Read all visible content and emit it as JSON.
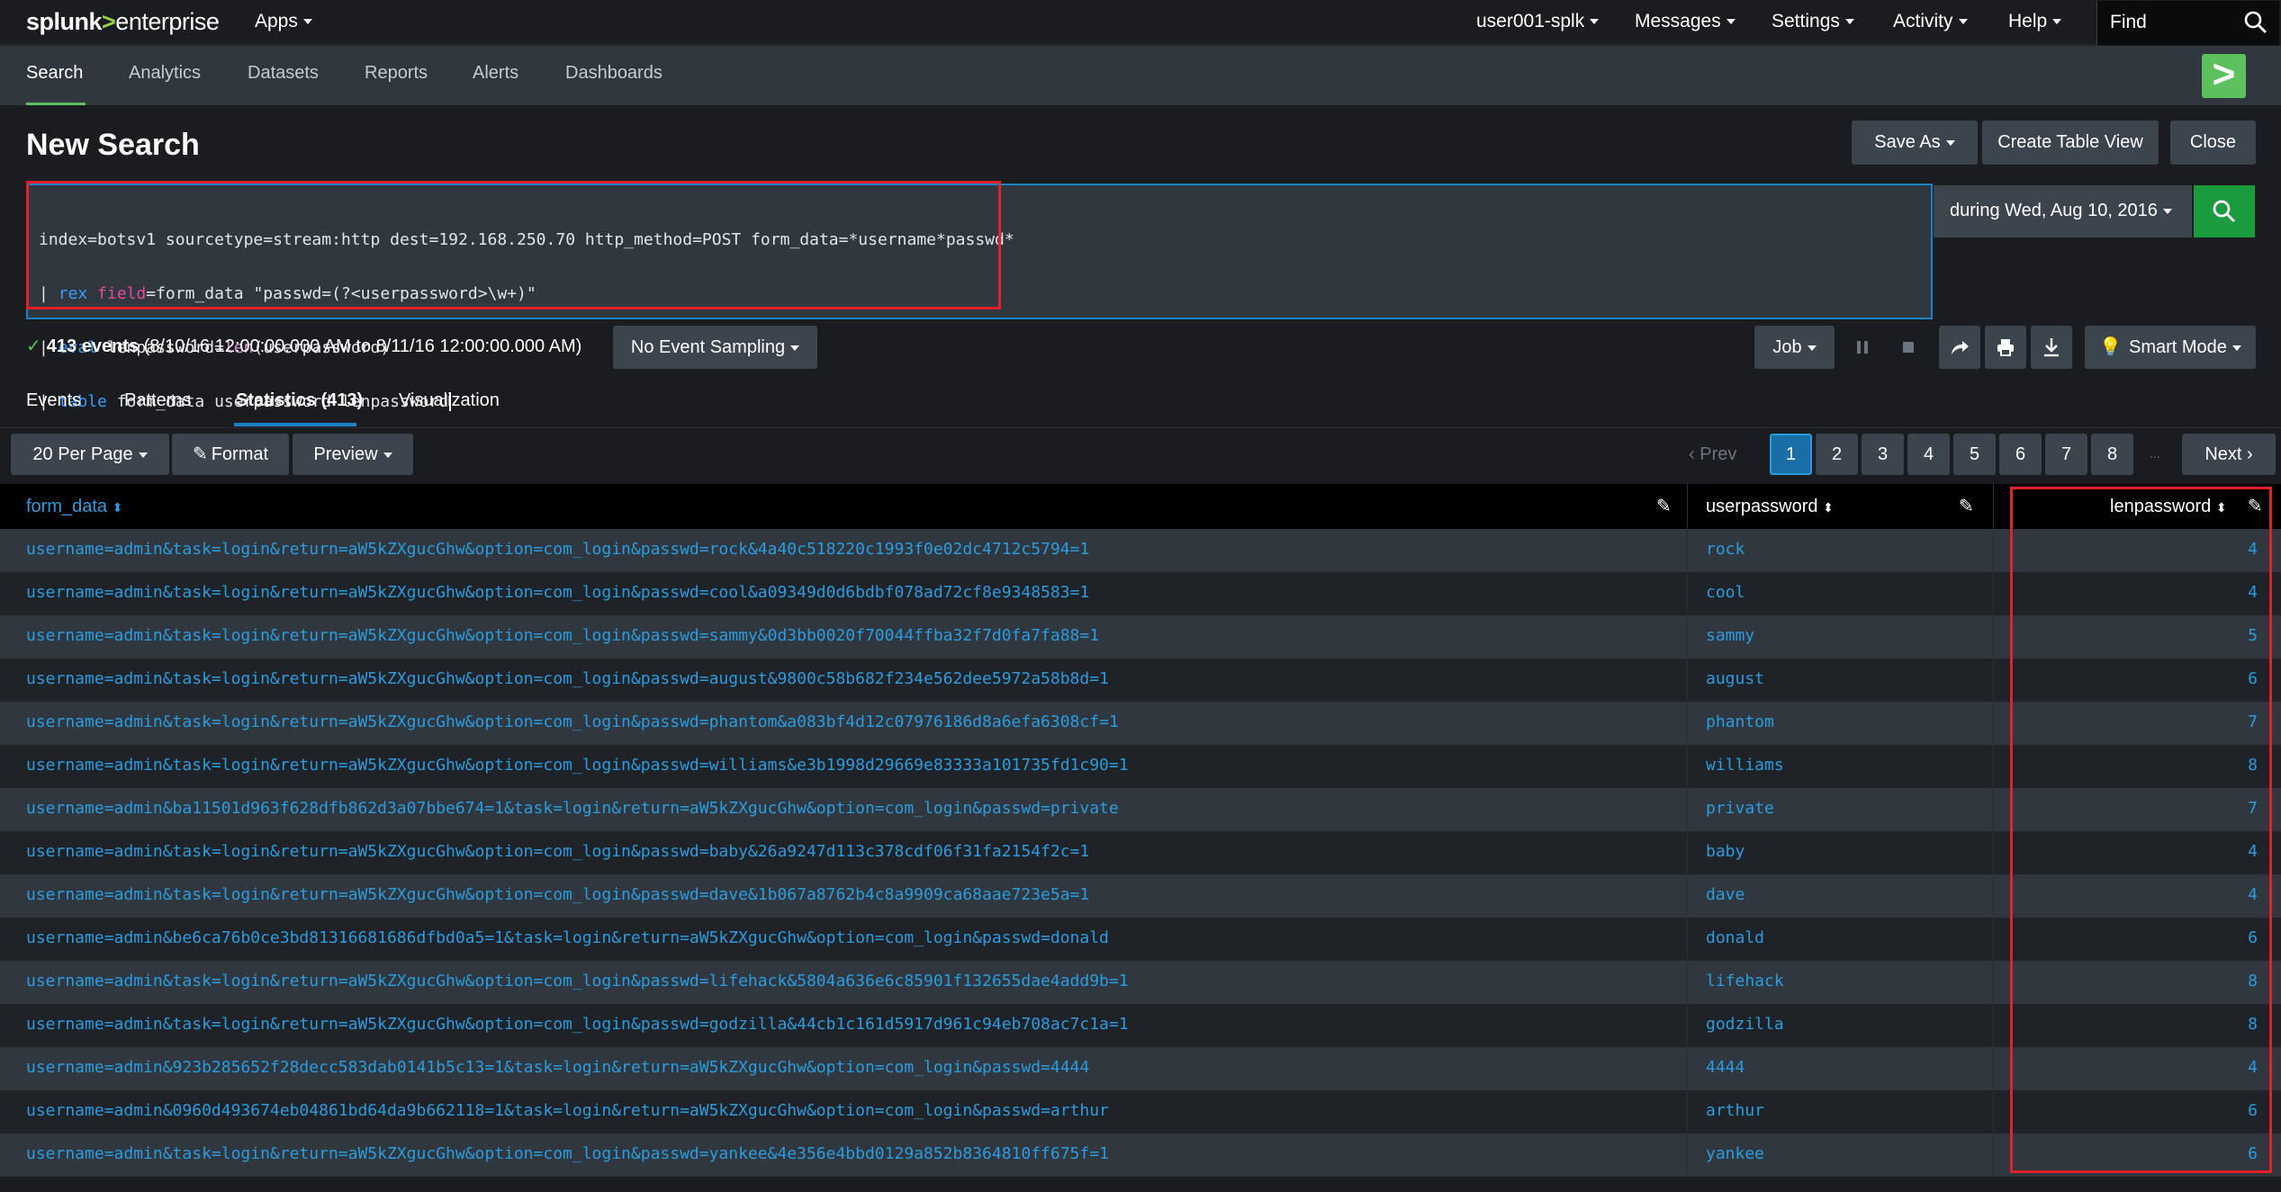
{
  "topbar": {
    "logo_brand": "splunk",
    "logo_sep": ">",
    "logo_product": "enterprise",
    "apps_label": "Apps",
    "user_label": "user001-splk",
    "messages_label": "Messages",
    "settings_label": "Settings",
    "activity_label": "Activity",
    "help_label": "Help",
    "find_label": "Find"
  },
  "nav": {
    "tabs": [
      "Search",
      "Analytics",
      "Datasets",
      "Reports",
      "Alerts",
      "Dashboards"
    ],
    "active": "Search",
    "app_icon_glyph": ">"
  },
  "page": {
    "title": "New Search",
    "save_as": "Save As",
    "create_table_view": "Create Table View",
    "close": "Close"
  },
  "search": {
    "line1": "index=botsv1 sourcetype=stream:http dest=192.168.250.70 http_method=POST form_data=*username*passwd*",
    "line2_pipe": "| ",
    "line2_cmd": "rex",
    "line2_arg": "field",
    "line2_rest": "=form_data \"passwd=(?<userpassword>\\w+)\"",
    "line3_pipe": "| ",
    "line3_cmd": "eval",
    "line3_mid": " lenpassword=",
    "line3_fn": "len",
    "line3_rest": "(userpassword)",
    "line4_pipe": "| ",
    "line4_cmd": "table",
    "line4_rest": " form_data userpassword lenpassword",
    "time_range": "during Wed, Aug 10, 2016"
  },
  "status": {
    "events": "413 events",
    "range": "(8/10/16 12:00:00.000 AM to 8/11/16 12:00:00.000 AM)",
    "sampling": "No Event Sampling",
    "job": "Job",
    "mode": "Smart Mode"
  },
  "result_tabs": {
    "events": "Events",
    "patterns": "Patterns",
    "statistics": "Statistics (413)",
    "visualization": "Visualization"
  },
  "toolbar": {
    "per_page": "20 Per Page",
    "format": "Format",
    "preview": "Preview"
  },
  "pagination": {
    "prev": "Prev",
    "pages": [
      "1",
      "2",
      "3",
      "4",
      "5",
      "6",
      "7",
      "8"
    ],
    "current": "1",
    "ellipsis": "...",
    "next": "Next"
  },
  "table": {
    "columns": [
      "form_data",
      "userpassword",
      "lenpassword"
    ],
    "rows": [
      {
        "form_data": "username=admin&task=login&return=aW5kZXgucGhw&option=com_login&passwd=rock&4a40c518220c1993f0e02dc4712c5794=1",
        "userpassword": "rock",
        "lenpassword": "4"
      },
      {
        "form_data": "username=admin&task=login&return=aW5kZXgucGhw&option=com_login&passwd=cool&a09349d0d6bdbf078ad72cf8e9348583=1",
        "userpassword": "cool",
        "lenpassword": "4"
      },
      {
        "form_data": "username=admin&task=login&return=aW5kZXgucGhw&option=com_login&passwd=sammy&0d3bb0020f70044ffba32f7d0fa7fa88=1",
        "userpassword": "sammy",
        "lenpassword": "5"
      },
      {
        "form_data": "username=admin&task=login&return=aW5kZXgucGhw&option=com_login&passwd=august&9800c58b682f234e562dee5972a58b8d=1",
        "userpassword": "august",
        "lenpassword": "6"
      },
      {
        "form_data": "username=admin&task=login&return=aW5kZXgucGhw&option=com_login&passwd=phantom&a083bf4d12c07976186d8a6efa6308cf=1",
        "userpassword": "phantom",
        "lenpassword": "7"
      },
      {
        "form_data": "username=admin&task=login&return=aW5kZXgucGhw&option=com_login&passwd=williams&e3b1998d29669e83333a101735fd1c90=1",
        "userpassword": "williams",
        "lenpassword": "8"
      },
      {
        "form_data": "username=admin&ba11501d963f628dfb862d3a07bbe674=1&task=login&return=aW5kZXgucGhw&option=com_login&passwd=private",
        "userpassword": "private",
        "lenpassword": "7"
      },
      {
        "form_data": "username=admin&task=login&return=aW5kZXgucGhw&option=com_login&passwd=baby&26a9247d113c378cdf06f31fa2154f2c=1",
        "userpassword": "baby",
        "lenpassword": "4"
      },
      {
        "form_data": "username=admin&task=login&return=aW5kZXgucGhw&option=com_login&passwd=dave&1b067a8762b4c8a9909ca68aae723e5a=1",
        "userpassword": "dave",
        "lenpassword": "4"
      },
      {
        "form_data": "username=admin&be6ca76b0ce3bd81316681686dfbd0a5=1&task=login&return=aW5kZXgucGhw&option=com_login&passwd=donald",
        "userpassword": "donald",
        "lenpassword": "6"
      },
      {
        "form_data": "username=admin&task=login&return=aW5kZXgucGhw&option=com_login&passwd=lifehack&5804a636e6c85901f132655dae4add9b=1",
        "userpassword": "lifehack",
        "lenpassword": "8"
      },
      {
        "form_data": "username=admin&task=login&return=aW5kZXgucGhw&option=com_login&passwd=godzilla&44cb1c161d5917d961c94eb708ac7c1a=1",
        "userpassword": "godzilla",
        "lenpassword": "8"
      },
      {
        "form_data": "username=admin&923b285652f28decc583dab0141b5c13=1&task=login&return=aW5kZXgucGhw&option=com_login&passwd=4444",
        "userpassword": "4444",
        "lenpassword": "4"
      },
      {
        "form_data": "username=admin&0960d493674eb04861bd64da9b662118=1&task=login&return=aW5kZXgucGhw&option=com_login&passwd=arthur",
        "userpassword": "arthur",
        "lenpassword": "6"
      },
      {
        "form_data": "username=admin&task=login&return=aW5kZXgucGhw&option=com_login&passwd=yankee&4e356e4bbd0129a852b8364810ff675f=1",
        "userpassword": "yankee",
        "lenpassword": "6"
      }
    ]
  },
  "colors": {
    "accent_green": "#5cc05c",
    "link_blue": "#2a9de0",
    "annotation_red": "#e0202a"
  }
}
